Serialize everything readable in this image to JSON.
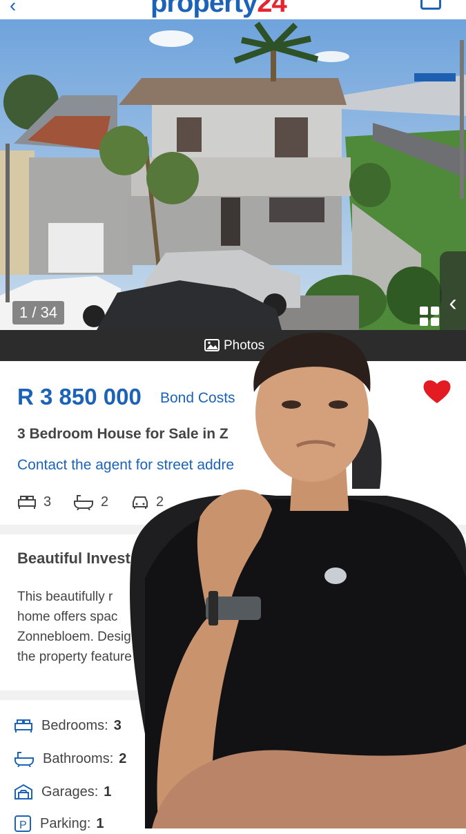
{
  "header": {
    "logo_text": "property",
    "logo_number": "24",
    "brand_blue": "#1c63b7",
    "brand_red": "#e3262f"
  },
  "gallery": {
    "counter": "1 / 34",
    "photos_label": "Photos"
  },
  "listing": {
    "price": "R 3 850 000",
    "bond_costs_label": "Bond Costs",
    "title": "3 Bedroom House for Sale in Z",
    "contact_link": "Contact the agent for street addre",
    "quick_features": {
      "bedrooms": "3",
      "bathrooms": "2",
      "garages": "2"
    },
    "favourite": true
  },
  "description": {
    "heading": "Beautiful Invest",
    "lines": [
      "This beautifully r",
      "home offers spac",
      "Zonnebloem. Desig",
      "the property feature"
    ]
  },
  "specs": [
    {
      "label": "Bedrooms:",
      "value": "3",
      "icon": "bed-icon"
    },
    {
      "label": "Bathrooms:",
      "value": "2",
      "icon": "bath-icon"
    },
    {
      "label": "Garages:",
      "value": "1",
      "icon": "garage-icon"
    },
    {
      "label": "Parking:",
      "value": "1",
      "icon": "parking-icon"
    }
  ]
}
